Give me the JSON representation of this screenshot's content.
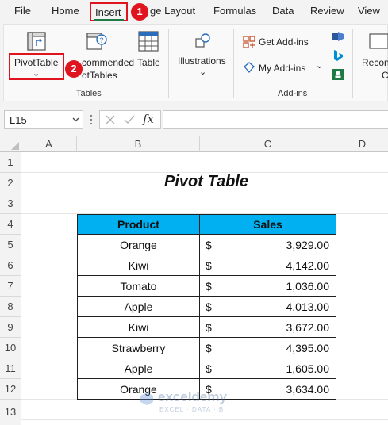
{
  "menu": {
    "tabs": [
      "File",
      "Home",
      "Insert",
      "ge Layout",
      "Formulas",
      "Data",
      "Review",
      "View"
    ],
    "active_tab": "Insert",
    "step1": "1",
    "step2": "2"
  },
  "ribbon": {
    "pivottable_label": "PivotTable",
    "recommended_line1": "commended",
    "recommended_line2": "otTables",
    "table_label": "Table",
    "tables_group": "Tables",
    "illustrations_label": "Illustrations",
    "get_addins": "Get Add-ins",
    "my_addins": "My Add-ins",
    "addins_group": "Add-ins",
    "recon_line1": "Recon",
    "recon_line2": "C",
    "chevron": "⌄"
  },
  "formula_bar": {
    "name_box": "L15",
    "fx": "fx",
    "value": ""
  },
  "grid": {
    "columns": [
      "A",
      "B",
      "C",
      "D"
    ],
    "rows": [
      "1",
      "2",
      "3",
      "4",
      "5",
      "6",
      "7",
      "8",
      "9",
      "10",
      "11",
      "12",
      "13"
    ]
  },
  "sheet": {
    "title": "Pivot Table",
    "headers": [
      "Product",
      "Sales"
    ],
    "rows": [
      {
        "product": "Orange",
        "currency": "$",
        "sales": "3,929.00"
      },
      {
        "product": "Kiwi",
        "currency": "$",
        "sales": "4,142.00"
      },
      {
        "product": "Tomato",
        "currency": "$",
        "sales": "1,036.00"
      },
      {
        "product": "Apple",
        "currency": "$",
        "sales": "4,013.00"
      },
      {
        "product": "Kiwi",
        "currency": "$",
        "sales": "3,672.00"
      },
      {
        "product": "Strawberry",
        "currency": "$",
        "sales": "4,395.00"
      },
      {
        "product": "Apple",
        "currency": "$",
        "sales": "1,605.00"
      },
      {
        "product": "Orange",
        "currency": "$",
        "sales": "3,634.00"
      }
    ]
  },
  "watermark": {
    "name": "exceldemy",
    "tagline": "EXCEL · DATA · BI"
  },
  "colors": {
    "highlight_red": "#e0141e",
    "header_blue": "#00b0f0",
    "excel_green": "#1d7a45"
  }
}
